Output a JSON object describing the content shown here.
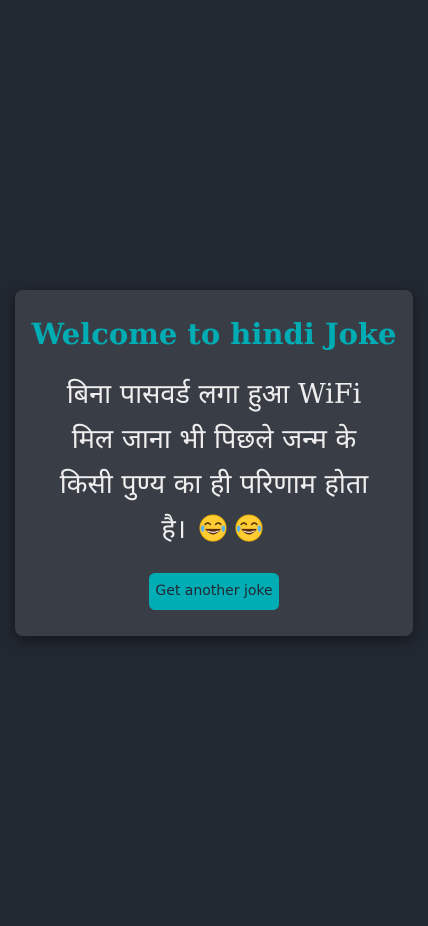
{
  "card": {
    "title": "Welcome to hindi Joke",
    "joke_text": "बिना पासवर्ड लगा हुआ WiFi मिल जाना भी पिछले जन्म के किसी पुण्य का ही परिणाम होता है।",
    "emojis": [
      "face-with-tears-of-joy-icon",
      "face-with-tears-of-joy-icon"
    ],
    "button_label": "Get another joke"
  },
  "colors": {
    "background": "#222831",
    "card": "#393e46",
    "accent": "#00adb5",
    "text": "#eeeeee"
  }
}
